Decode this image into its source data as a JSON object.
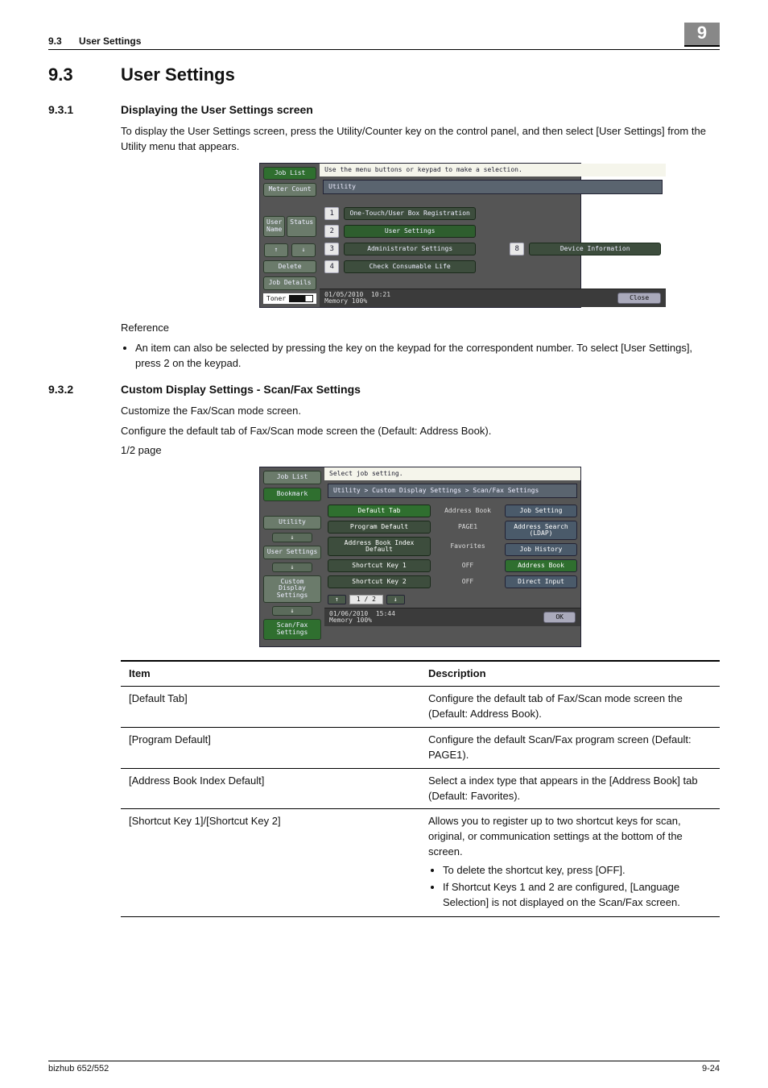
{
  "header": {
    "section_num": "9.3",
    "section_title": "User Settings",
    "chapter_tab": "9"
  },
  "h2": {
    "num": "9.3",
    "title": "User Settings"
  },
  "s1": {
    "num": "9.3.1",
    "title": "Displaying the User Settings screen",
    "para": "To display the User Settings screen, press the Utility/Counter key on the control panel, and then select [User Settings] from the Utility menu that appears.",
    "ref_label": "Reference",
    "ref_item": "An item can also be selected by pressing the key on the keypad for the correspondent number. To select [User Settings], press 2 on the keypad."
  },
  "panel1": {
    "topbar": "Use the menu buttons or keypad to make a selection.",
    "title": "Utility",
    "side": {
      "joblist": "Job List",
      "meter": "Meter Count",
      "user": "User Name",
      "status": "Status",
      "delete": "Delete",
      "jobdetails": "Job Details",
      "toner": "Toner"
    },
    "items": [
      {
        "n": "1",
        "label": "One-Touch/User Box Registration"
      },
      {
        "n": "2",
        "label": "User Settings"
      },
      {
        "n": "3",
        "label": "Administrator Settings",
        "n2": "8",
        "label2": "Device Information"
      },
      {
        "n": "4",
        "label": "Check Consumable Life"
      }
    ],
    "footer_date": "01/05/2010",
    "footer_time": "10:21",
    "footer_mem": "Memory   100%",
    "close": "Close"
  },
  "s2": {
    "num": "9.3.2",
    "title": "Custom Display Settings - Scan/Fax Settings",
    "p1": "Customize the Fax/Scan mode screen.",
    "p2": "Configure the default tab of Fax/Scan mode screen the (Default: Address Book).",
    "p3": "1/2 page"
  },
  "panel2": {
    "topbar": "Select job setting.",
    "breadcrumb": "Utility > Custom Display Settings > Scan/Fax Settings",
    "side": {
      "joblist": "Job List",
      "bookmark": "Bookmark",
      "utility": "Utility",
      "user": "User Settings",
      "custom": "Custom Display Settings",
      "scanfax": "Scan/Fax Settings"
    },
    "left": [
      {
        "label": "Default Tab",
        "value": "Address Book",
        "hdr": true
      },
      {
        "label": "Program Default",
        "value": "PAGE1"
      },
      {
        "label": "Address Book Index Default",
        "value": "Favorites"
      },
      {
        "label": "Shortcut Key 1",
        "value": "OFF"
      },
      {
        "label": "Shortcut Key 2",
        "value": "OFF"
      }
    ],
    "right": [
      "Job Setting",
      "Address Search (LDAP)",
      "Job History",
      "Address Book",
      "Direct Input"
    ],
    "page": "1 / 2",
    "footer_date": "01/06/2010",
    "footer_time": "15:44",
    "footer_mem": "Memory   100%",
    "ok": "OK"
  },
  "table": {
    "h1": "Item",
    "h2": "Description",
    "rows": [
      {
        "item": "[Default Tab]",
        "desc": "Configure the default tab of Fax/Scan mode screen the (Default: Address Book)."
      },
      {
        "item": "[Program Default]",
        "desc": "Configure the default Scan/Fax program screen (Default: PAGE1)."
      },
      {
        "item": "[Address Book Index Default]",
        "desc": "Select a index type that appears in the [Address Book] tab (Default: Favorites)."
      },
      {
        "item": "[Shortcut Key 1]/[Shortcut Key 2]",
        "desc": "Allows you to register up to two shortcut keys for scan, original, or communication settings at the bottom of the screen.",
        "bullets": [
          "To delete the shortcut key, press [OFF].",
          "If Shortcut Keys 1 and 2 are configured, [Language Selection] is not displayed on the Scan/Fax screen."
        ]
      }
    ]
  },
  "footer": {
    "product": "bizhub 652/552",
    "page": "9-24"
  }
}
